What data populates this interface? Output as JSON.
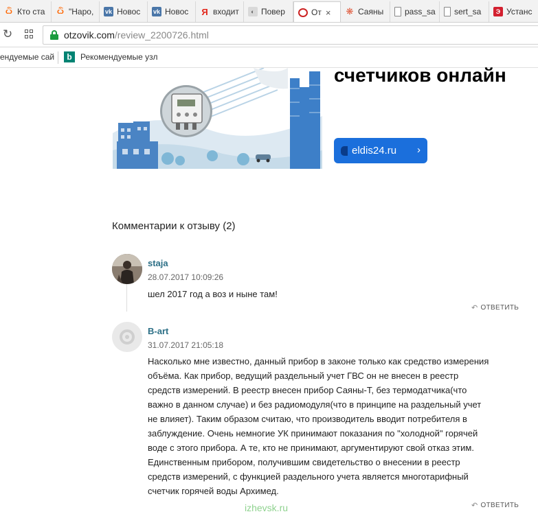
{
  "browser": {
    "tabs": [
      {
        "icon": "ok-icon",
        "title": "Кто ста",
        "active": false
      },
      {
        "icon": "ok-icon",
        "title": "\"Наро,",
        "active": false
      },
      {
        "icon": "vk-icon",
        "title": "Новос",
        "active": false
      },
      {
        "icon": "vk-icon",
        "title": "Новос",
        "active": false
      },
      {
        "icon": "yandex-icon",
        "title": "входит",
        "active": false
      },
      {
        "icon": "page-icon",
        "title": "Повер",
        "active": false
      },
      {
        "icon": "otzovik-icon",
        "title": "От",
        "active": true
      },
      {
        "icon": "sayany-icon",
        "title": "Саяны",
        "active": false
      },
      {
        "icon": "document-icon",
        "title": "pass_sa",
        "active": false
      },
      {
        "icon": "document-icon",
        "title": "sert_sa",
        "active": false
      },
      {
        "icon": "site-icon",
        "title": "Устанс",
        "active": false
      }
    ],
    "tab_close": "×",
    "url_host": "otzovik.com",
    "url_path": "/review_2200726.html",
    "bookmarks": [
      {
        "label": "ендуемые сай"
      },
      {
        "label": "Рекомендуемые узл"
      }
    ]
  },
  "banner": {
    "title": "счетчиков онлайн",
    "button_label": "eldis24.ru",
    "button_chevron": "›"
  },
  "comments": {
    "heading": "Комментарии к отзыву (2)",
    "reply_label": "ОТВЕТИТЬ",
    "items": [
      {
        "author": "staja",
        "date": "28.07.2017 10:09:26",
        "text": "шел 2017 год а воз и ныне там!"
      },
      {
        "author": "B-art",
        "date": "31.07.2017 21:05:18",
        "text_lines": [
          "Насколько мне известно, данный прибор в законе только как средство измерения",
          "объёма. Как прибор, ведущий раздельный учет ГВС он не внесен в реестр",
          "средств измерений. В реестр внесен прибор Саяны-Т, без термодатчика(что",
          "важно в данном случае) и без радиомодуля(что в принципе на раздельный учет",
          "не влияет). Таким образом считаю, что производитель вводит потребителя в",
          "заблуждение. Очень немногие УК принимают показания по \"холодной\" горячей",
          "воде с этого прибора. А те, кто не принимают, аргументируют свой отказ этим.",
          "Единственным прибором, получившим свидетельство о внесении в реестр",
          "средств измерений, с функцией раздельного учета является многотарифный",
          "счетчик горячей воды Архимед."
        ]
      }
    ]
  },
  "watermark": "izhevsk.ru",
  "colors": {
    "author_link": "#2c6f86",
    "banner_button": "#1b6fdc",
    "lock_green": "#1a9c3e"
  }
}
